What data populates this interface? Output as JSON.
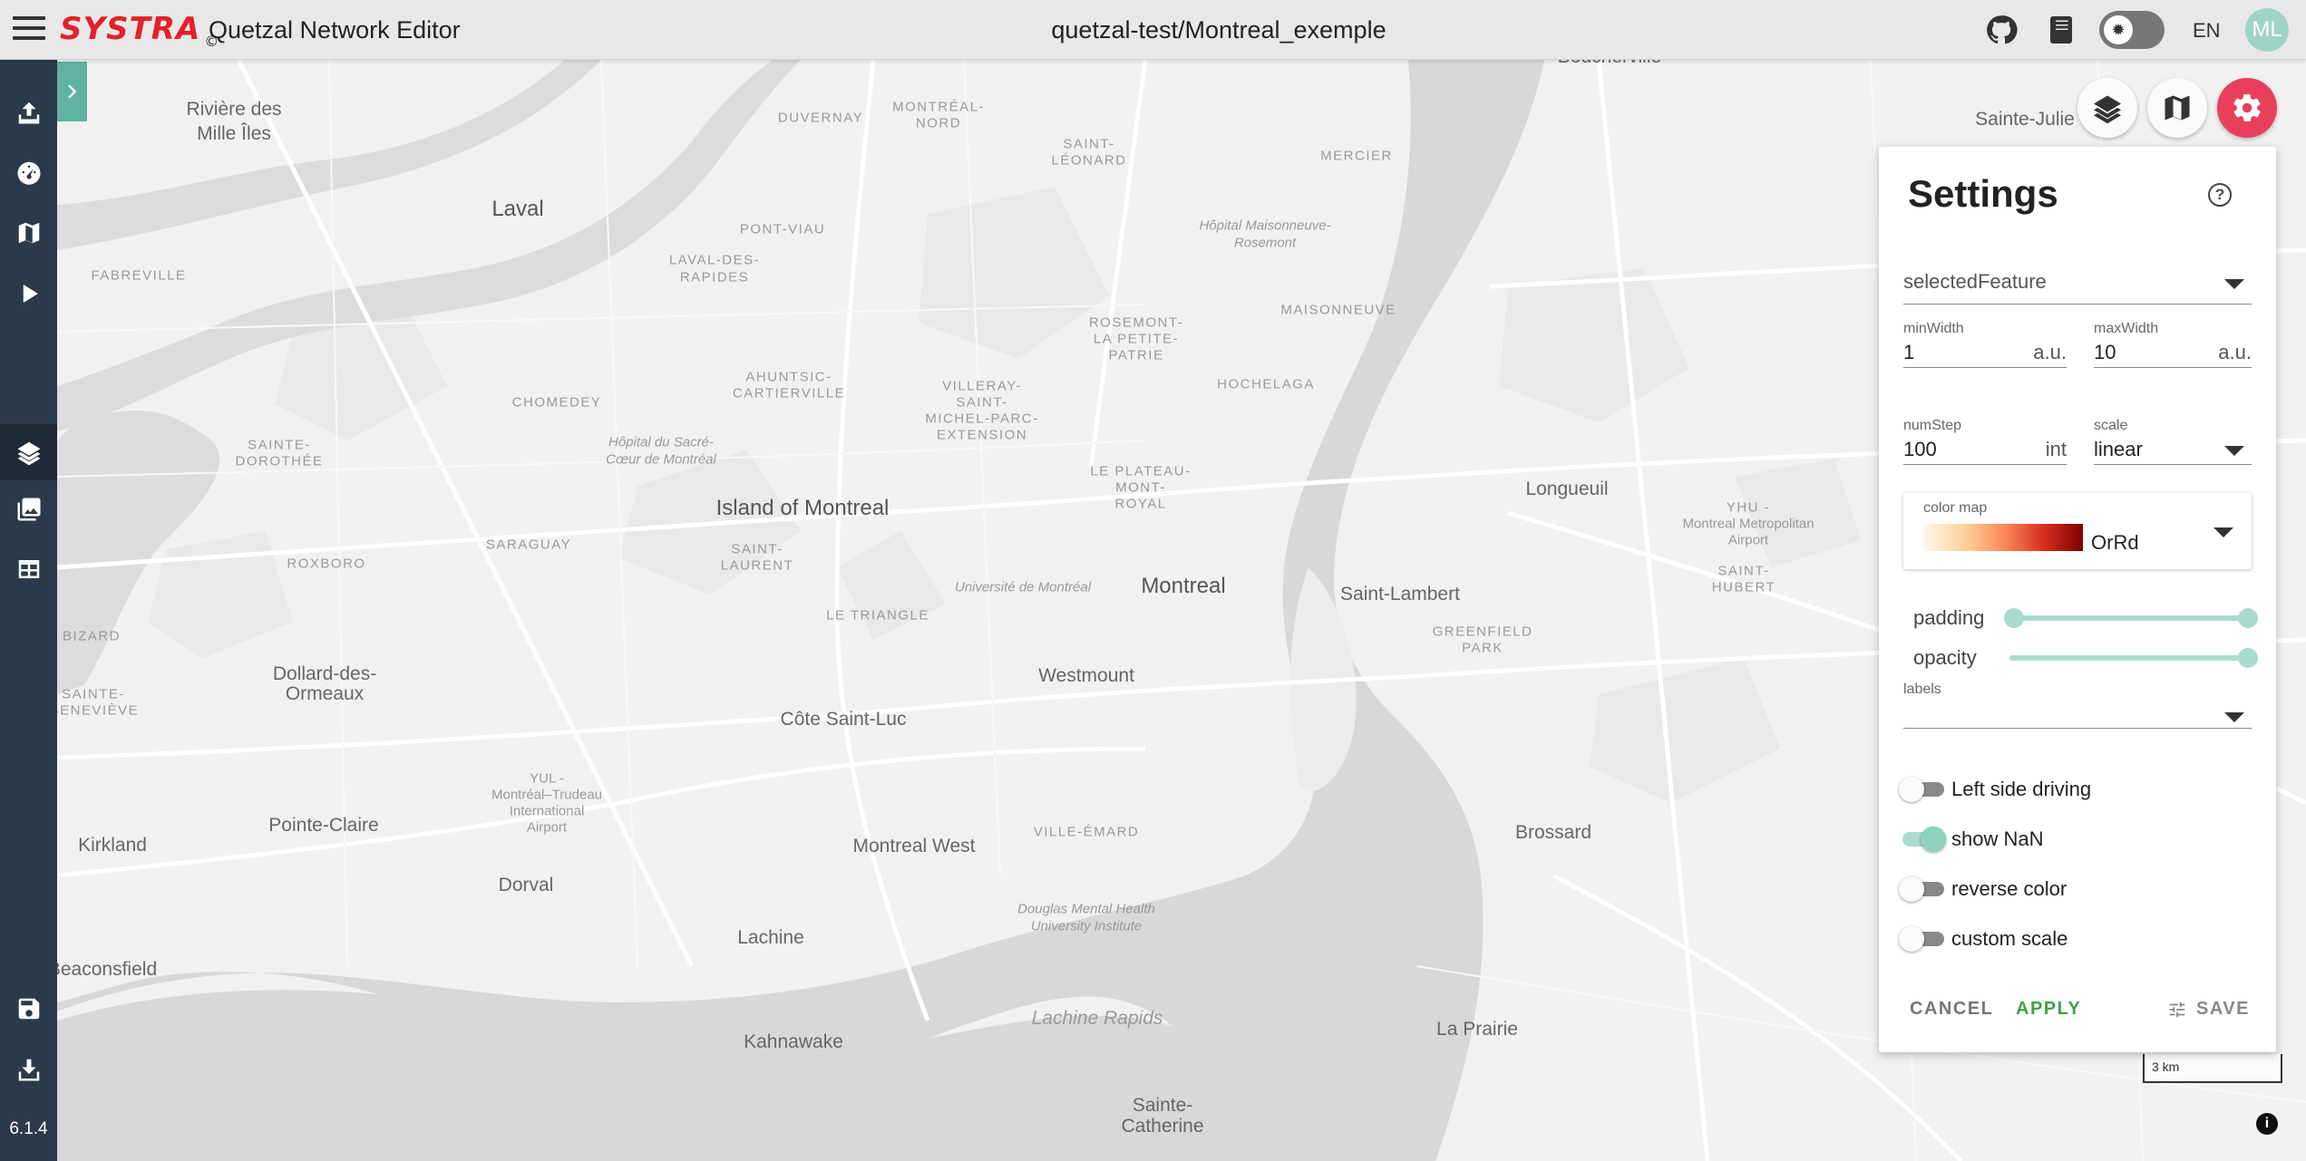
{
  "header": {
    "logo": "SYSTRA",
    "logo_mark": "©",
    "app_title": "Quetzal Network Editor",
    "project_title": "quetzal-test/Montreal_exemple",
    "github_icon": "github-icon",
    "docs_icon": "book-icon",
    "theme_icon": "theme-toggle-icon",
    "language": "EN",
    "avatar_initials": "ML"
  },
  "sidebar": {
    "items": [
      {
        "icon": "upload-icon"
      },
      {
        "icon": "dashboard-icon"
      },
      {
        "icon": "map-icon"
      },
      {
        "icon": "play-icon"
      },
      {
        "icon": "layers-icon",
        "active": true
      },
      {
        "icon": "images-icon"
      },
      {
        "icon": "table-icon"
      },
      {
        "icon": "save-icon"
      },
      {
        "icon": "download-icon"
      }
    ],
    "version": "6.1.4"
  },
  "map": {
    "labels": {
      "riviere_des_mille_iles_1": "Rivière des",
      "riviere_des_mille_iles_2": "Mille Îles",
      "laval": "Laval",
      "duvernay": "DUVERNAY",
      "montreal_nord_1": "MONTRÉAL-",
      "montreal_nord_2": "NORD",
      "saint_leonard_1": "SAINT-",
      "saint_leonard_2": "LÉONARD",
      "mercier": "MERCIER",
      "boucherville": "Boucherville",
      "sainte_julie": "Sainte-Julie",
      "fabreville": "FABREVILLE",
      "pont_viau": "PONT-VIAU",
      "hopital_maisonneuve_1": "Hôpital Maisonneuve-",
      "hopital_maisonneuve_2": "Rosemont",
      "laval_des_rapides_1": "LAVAL-DES-",
      "laval_des_rapides_2": "RAPIDES",
      "rosemont_1": "ROSEMONT-",
      "rosemont_2": "LA PETITE-",
      "rosemont_3": "PATRIE",
      "maisonneuve": "MAISONNEUVE",
      "ahuntsic_1": "AHUNTSIC-",
      "ahuntsic_2": "CARTIERVILLE",
      "villeray_1": "VILLERAY-",
      "villeray_2": "SAINT-",
      "villeray_3": "MICHEL-PARC-",
      "villeray_4": "EXTENSION",
      "hochelaga": "HOCHELAGA",
      "chomedey": "CHOMEDEY",
      "sainte_dorothee_1": "SAINTE-",
      "sainte_dorothee_2": "DOROTHÉE",
      "hopital_sacre_coeur_1": "Hôpital du Sacré-",
      "hopital_sacre_coeur_2": "Cœur de Montréal",
      "island_of_montreal": "Island of Montreal",
      "plateau_1": "LE PLATEAU-",
      "plateau_2": "MONT-",
      "plateau_3": "ROYAL",
      "longueuil": "Longueuil",
      "yhu_1": "YHU -",
      "yhu_2": "Montreal Metropolitan",
      "yhu_3": "Airport",
      "saraguay": "SARAGUAY",
      "saint_laurent_1": "SAINT-",
      "saint_laurent_2": "LAURENT",
      "roxboro": "ROXBORO",
      "universite_de_montreal": "Université de Montréal",
      "montreal": "Montreal",
      "saint_lambert": "Saint-Lambert",
      "saint_hubert_1": "SAINT-",
      "saint_hubert_2": "HUBERT",
      "le_triangle": "LE TRIANGLE",
      "greenfield_park_1": "GREENFIELD",
      "greenfield_park_2": "PARK",
      "bizard": "BIZARD",
      "dollard_1": "Dollard-des-",
      "dollard_2": "Ormeaux",
      "westmount": "Westmount",
      "sainte_genevieve_1": "SAINTE-",
      "sainte_genevieve_2": "GENEVIÈVE",
      "cote_saint_luc": "Côte Saint-Luc",
      "yul_1": "YUL -",
      "yul_2": "Montréal–Trudeau",
      "yul_3": "International",
      "yul_4": "Airport",
      "pointe_claire": "Pointe-Claire",
      "ville_emard": "VILLE-ÉMARD",
      "kirkland": "Kirkland",
      "montreal_west": "Montreal West",
      "brossard": "Brossard",
      "dorval": "Dorval",
      "douglas_1": "Douglas Mental Health",
      "douglas_2": "University Institute",
      "lachine": "Lachine",
      "beaconsfield": "Beaconsfield",
      "lachine_rapids": "Lachine Rapids",
      "la_prairie": "La Prairie",
      "kahnawake": "Kahnawake",
      "sainte_catherine_1": "Sainte-",
      "sainte_catherine_2": "Catherine"
    },
    "scale": "3 km",
    "buttons": [
      {
        "icon": "layers-icon"
      },
      {
        "icon": "map-icon"
      },
      {
        "icon": "gear-icon"
      }
    ]
  },
  "settings": {
    "title": "Settings",
    "help_icon": "help-icon",
    "selected_feature": "selectedFeature",
    "min_width": {
      "label": "minWidth",
      "value": "1",
      "unit": "a.u."
    },
    "max_width": {
      "label": "maxWidth",
      "value": "10",
      "unit": "a.u."
    },
    "num_step": {
      "label": "numStep",
      "value": "100",
      "unit": "int"
    },
    "scale": {
      "label": "scale",
      "value": "linear"
    },
    "color_map": {
      "label": "color map",
      "value": "OrRd",
      "colors": [
        "#fff7ec",
        "#fdd49e",
        "#fc8d59",
        "#d7301f",
        "#7f0000"
      ]
    },
    "padding": {
      "label": "padding",
      "min": 0,
      "max": 1
    },
    "opacity": {
      "label": "opacity",
      "value": 1
    },
    "labels": {
      "label": "labels",
      "value": ""
    },
    "toggles": [
      {
        "label": "Left side driving",
        "on": false
      },
      {
        "label": "show NaN",
        "on": true
      },
      {
        "label": "reverse color",
        "on": false
      },
      {
        "label": "custom scale",
        "on": false
      }
    ],
    "cancel": "CANCEL",
    "apply": "APPLY",
    "save": "SAVE",
    "accent": "#43a047",
    "slider_color": "#a9dccf"
  }
}
